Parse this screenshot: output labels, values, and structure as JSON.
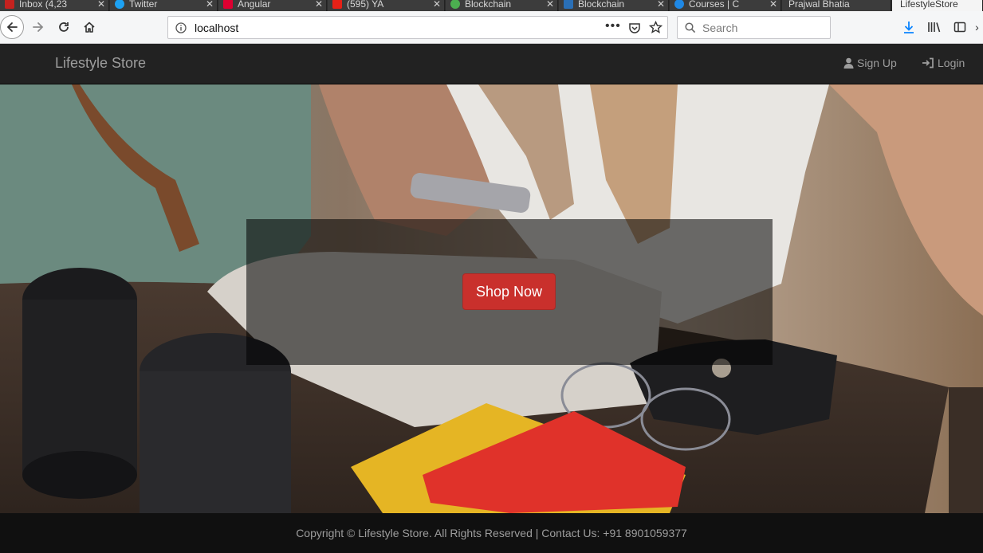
{
  "browser": {
    "tabs": [
      {
        "title": "Inbox (4,23",
        "favicon_color": "#c5221f"
      },
      {
        "title": "Twitter",
        "favicon_color": "#1da1f2"
      },
      {
        "title": "Angular",
        "favicon_color": "#dd0031"
      },
      {
        "title": "(595) YA",
        "favicon_color": "#e62117"
      },
      {
        "title": "Blockchain",
        "favicon_color": "#4caf50"
      },
      {
        "title": "Blockchain",
        "favicon_color": "#2a6fb6"
      },
      {
        "title": "Courses | C",
        "favicon_color": "#1f88e5"
      },
      {
        "title": "Prajwal Bhatia",
        "favicon_color": ""
      },
      {
        "title": "LifestyleStore",
        "favicon_color": ""
      }
    ],
    "url": "localhost",
    "search_placeholder": "Search"
  },
  "site": {
    "brand": "Lifestyle Store",
    "nav": {
      "signup_label": "Sign Up",
      "login_label": "Login"
    },
    "hero": {
      "button_label": "Shop Now"
    },
    "footer": {
      "text": "Copyright © Lifestyle Store. All Rights Reserved | Contact Us: +91 8901059377"
    },
    "colors": {
      "navbar": "#222222",
      "footer": "#101010",
      "button": "#c9302c"
    }
  }
}
